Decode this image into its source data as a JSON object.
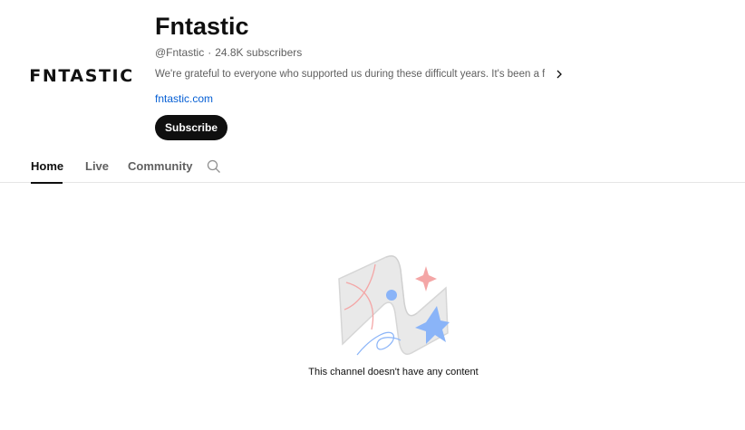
{
  "channel": {
    "logo_text": "FNTASTIC",
    "name": "Fntastic",
    "handle": "@Fntastic",
    "separator": "·",
    "subscribers": "24.8K subscribers",
    "description": "We're grateful to everyone who supported us during these difficult years. It's been a fantast...",
    "link": "fntastic.com",
    "subscribe_label": "Subscribe"
  },
  "tabs": [
    {
      "label": "Home",
      "active": true
    },
    {
      "label": "Live",
      "active": false
    },
    {
      "label": "Community",
      "active": false
    }
  ],
  "empty_state": {
    "message": "This channel doesn't have any content"
  },
  "colors": {
    "link": "#065fd4",
    "button_bg": "#0f0f0f",
    "secondary_text": "#606060",
    "illustration_pink": "#f4a6a6",
    "illustration_blue": "#8ab4f8"
  }
}
